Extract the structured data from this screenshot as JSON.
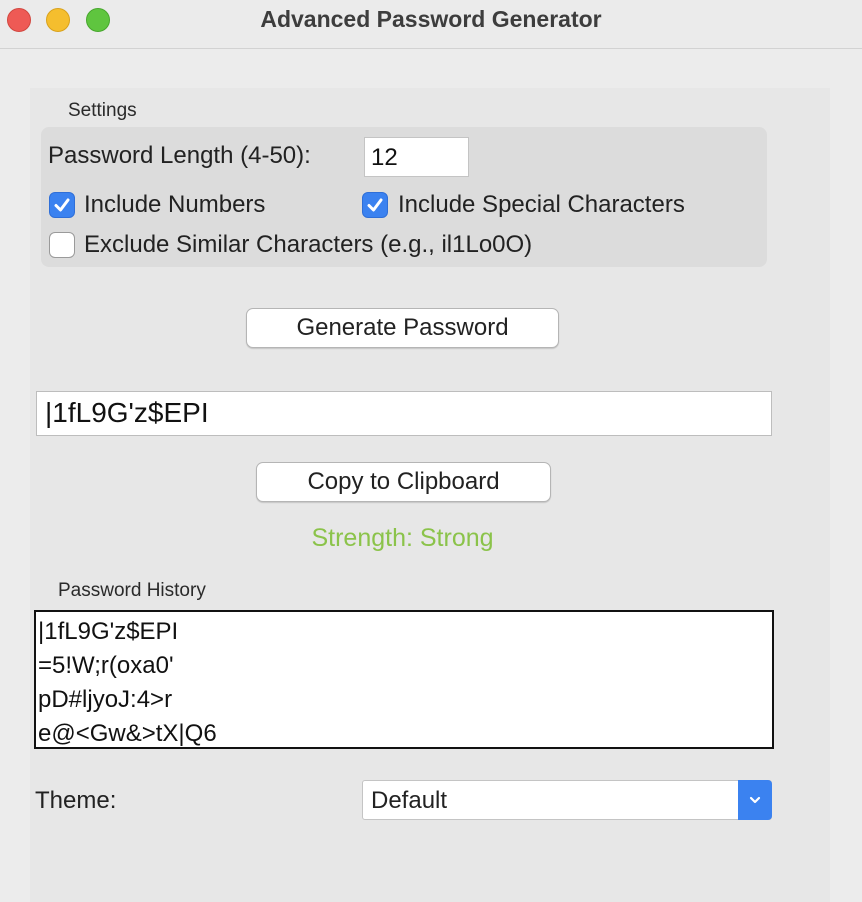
{
  "window": {
    "title": "Advanced Password Generator"
  },
  "settings": {
    "label": "Settings",
    "length_label": "Password Length (4-50):",
    "length_value": "12",
    "include_numbers": {
      "label": "Include Numbers",
      "checked": true
    },
    "include_special": {
      "label": "Include Special Characters",
      "checked": true
    },
    "exclude_similar": {
      "label": "Exclude Similar Characters (e.g., il1Lo0O)",
      "checked": false
    }
  },
  "generate_label": "Generate Password",
  "password_value": "|1fL9G'z$EPI",
  "copy_label": "Copy to Clipboard",
  "strength": {
    "text": "Strength: Strong",
    "color": "#8bc34a"
  },
  "history": {
    "label": "Password History",
    "items": [
      "|1fL9G'z$EPI",
      "=5!W;r(oxa0'",
      "pD#ljyoJ:4>r",
      "e@<Gw&>tX|Q6"
    ]
  },
  "theme": {
    "label": "Theme:",
    "value": "Default"
  },
  "colors": {
    "accent": "#3b82f0",
    "close": "#ee5a55",
    "minimize": "#f5be2e",
    "zoom": "#5fc53f"
  },
  "icons": {
    "checkbox_checked": "checkmark-icon",
    "select": "chevron-down-icon"
  }
}
